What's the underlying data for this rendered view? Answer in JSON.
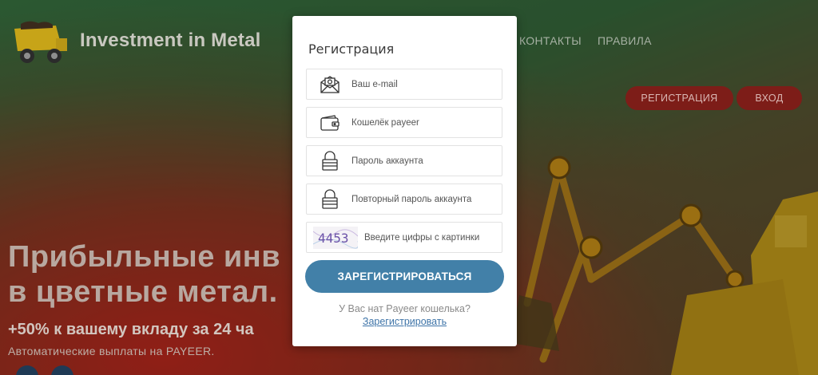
{
  "header": {
    "logo_text": "Investment in Metal",
    "nav": [
      {
        "label": "КОНТАКТЫ"
      },
      {
        "label": "ПРАВИЛА"
      }
    ],
    "register_button": "РЕГИСТРАЦИЯ",
    "login_button": "ВХОД"
  },
  "hero": {
    "title_line1": "Прибыльные инв",
    "title_line2": "в цветные метал.",
    "subtitle": "+50% к вашему вкладу за 24 ча",
    "note": "Автоматические выплаты на PAYEER."
  },
  "modal": {
    "title": "Регистрация",
    "fields": {
      "email_placeholder": "Ваш e-mail",
      "wallet_placeholder": "Кошелёк payeer",
      "password_placeholder": "Пароль аккаунта",
      "password_repeat_placeholder": "Повторный пароль аккаунта",
      "captcha_placeholder": "Введите цифры с картинки"
    },
    "captcha_text": "4453",
    "submit_label": "ЗАРЕГИСТРИРОВАТЬСЯ",
    "hint_text": "У Вас нат Payeer кошелька?",
    "hint_link": "Зарегистрировать"
  },
  "colors": {
    "submit_bg": "#4280a8",
    "link": "#3e74a8",
    "pill_bg": "#7d1d18"
  }
}
